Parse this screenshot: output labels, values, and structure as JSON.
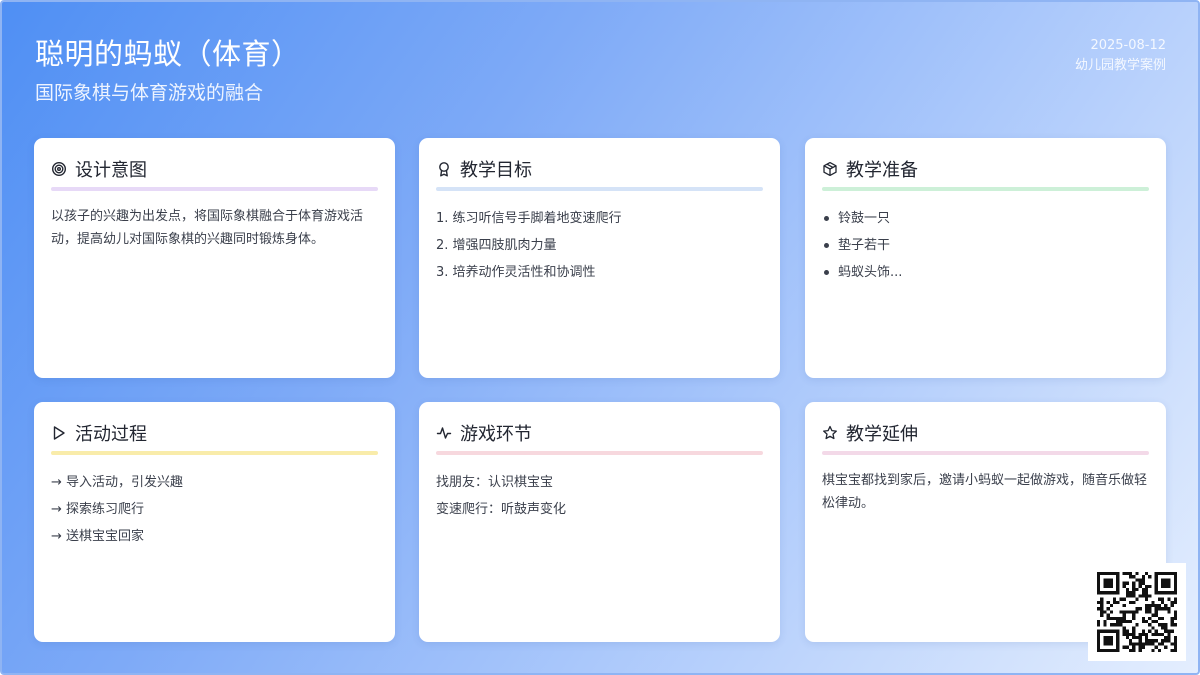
{
  "header": {
    "title": "聪明的蚂蚁（体育）",
    "subtitle": "国际象棋与体育游戏的融合",
    "date": "2025-08-12",
    "category": "幼儿园教学案例"
  },
  "cards": {
    "design": {
      "icon": "target-icon",
      "title": "设计意图",
      "accent": "#e7d9f7",
      "text": "以孩子的兴趣为出发点，将国际象棋融合于体育游戏活动，提高幼儿对国际象棋的兴趣同时锻炼身体。"
    },
    "goals": {
      "icon": "award-icon",
      "title": "教学目标",
      "accent": "#d5e3f7",
      "items": [
        "1. 练习听信号手脚着地变速爬行",
        "2. 增强四肢肌肉力量",
        "3. 培养动作灵活性和协调性"
      ]
    },
    "prep": {
      "icon": "box-icon",
      "title": "教学准备",
      "accent": "#cdf0d8",
      "items": [
        "铃鼓一只",
        "垫子若干",
        "蚂蚁头饰..."
      ]
    },
    "process": {
      "icon": "play-icon",
      "title": "活动过程",
      "accent": "#f9ecaa",
      "items": [
        "→ 导入活动，引发兴趣",
        "→ 探索练习爬行",
        "→ 送棋宝宝回家"
      ]
    },
    "games": {
      "icon": "activity-icon",
      "title": "游戏环节",
      "accent": "#f7d8de",
      "items": [
        "找朋友：认识棋宝宝",
        "变速爬行：听鼓声变化"
      ]
    },
    "extension": {
      "icon": "star-icon",
      "title": "教学延伸",
      "accent": "#f3d9e8",
      "text": "棋宝宝都找到家后，邀请小蚂蚁一起做游戏，随音乐做轻松律动。"
    }
  },
  "qr": {
    "icon": "qr-code-icon"
  }
}
